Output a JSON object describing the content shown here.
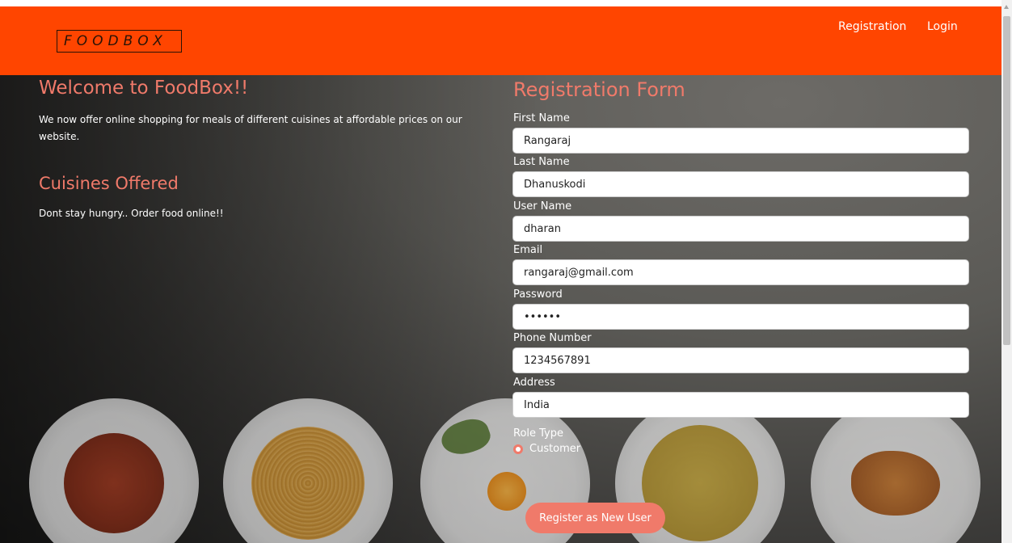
{
  "navbar": {
    "brand": "FOODBOX",
    "links": [
      "Registration",
      "Login"
    ],
    "color": "#ff4500"
  },
  "welcome": {
    "title": "Welcome to FoodBox!!",
    "text": "We now offer online shopping for meals of different cuisines at affordable prices on our website."
  },
  "cuisines": {
    "title": "Cuisines Offered",
    "text": "Dont stay hungry.. Order food online!!"
  },
  "form": {
    "title": "Registration Form",
    "fields": [
      {
        "label": "First Name",
        "value": "Rangaraj"
      },
      {
        "label": "Last Name",
        "value": "Dhanuskodi"
      },
      {
        "label": "User Name",
        "value": "dharan"
      },
      {
        "label": "Email",
        "value": "rangaraj@gmail.com"
      },
      {
        "label": "Password",
        "value": "••••••"
      },
      {
        "label": "Phone Number",
        "value": "1234567891"
      },
      {
        "label": "Address",
        "value": "India"
      }
    ],
    "role": {
      "label": "Role Type",
      "option": "Customer",
      "selected": true
    },
    "submit_label": "Register as New User",
    "accent_color": "#f07a6a"
  }
}
